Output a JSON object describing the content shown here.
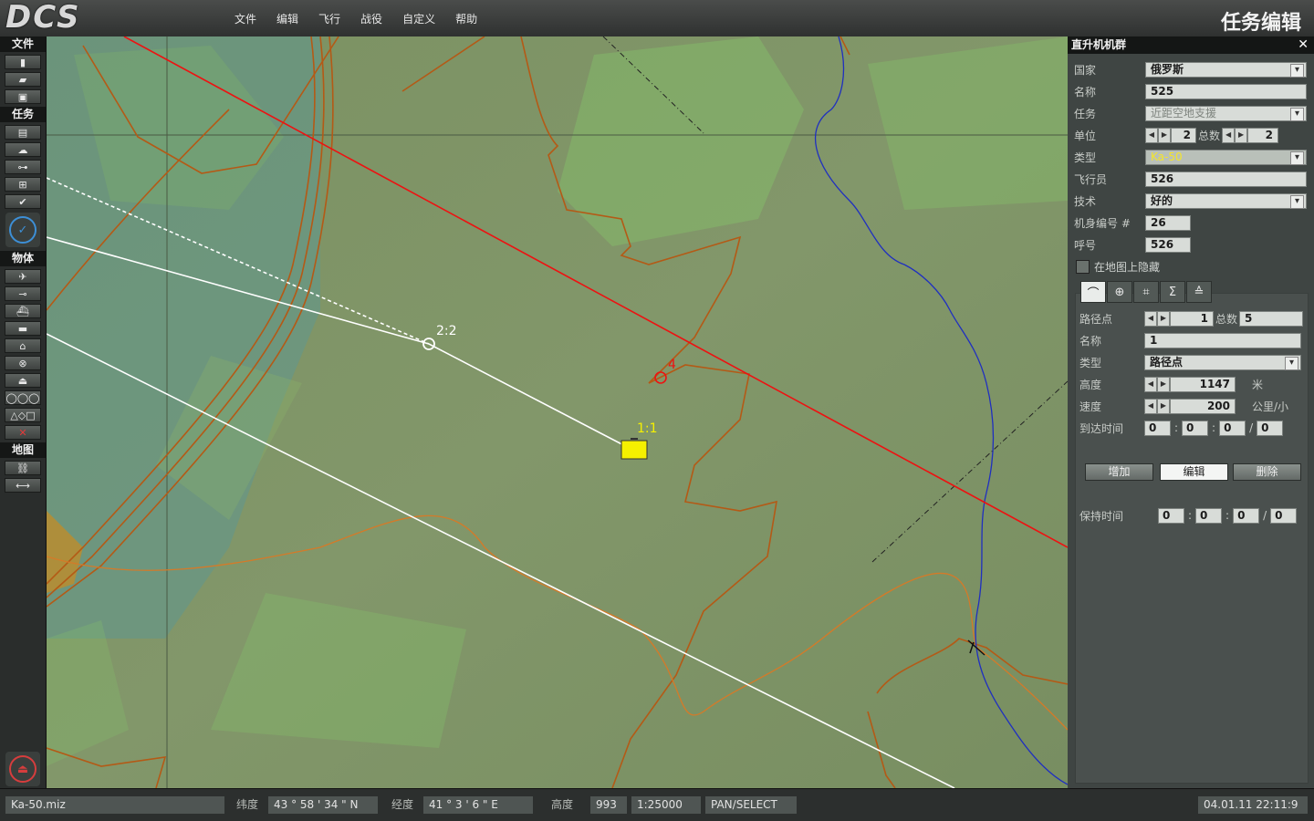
{
  "app": {
    "logo": "DCS",
    "title": "任务编辑"
  },
  "menu": [
    "文件",
    "编辑",
    "飞行",
    "战役",
    "自定义",
    "帮助"
  ],
  "toolbar": {
    "sections": {
      "file": "文件",
      "mission": "任务",
      "objects": "物体",
      "map": "地图"
    }
  },
  "map": {
    "waypoint_labels": {
      "group_start": "1:1",
      "wp2": "2:2",
      "red_marker": "4"
    },
    "colors": {
      "group_icon": "#f5f000",
      "red_route": "#ee1111",
      "white_route": "#ffffff",
      "boundary": "#b45a16",
      "river": "#1f2fc0"
    }
  },
  "panel": {
    "title": "直升机机群",
    "close": "✕",
    "country": {
      "label": "国家",
      "value": "俄罗斯"
    },
    "name": {
      "label": "名称",
      "value": "525"
    },
    "task": {
      "label": "任务",
      "value": "近距空地支援"
    },
    "unit": {
      "label": "单位",
      "value": "2",
      "total_label": "总数",
      "total": "2"
    },
    "type": {
      "label": "类型",
      "value": "Ka-50"
    },
    "pilot": {
      "label": "飞行员",
      "value": "526"
    },
    "skill": {
      "label": "技术",
      "value": "好的"
    },
    "tail": {
      "label": "机身编号 #",
      "value": "26"
    },
    "callsign": {
      "label": "呼号",
      "value": "526"
    },
    "hidden": {
      "label": "在地图上隐藏"
    },
    "waypoint": {
      "wp": {
        "label": "路径点",
        "value": "1",
        "total_label": "总数",
        "total": "5"
      },
      "name": {
        "label": "名称",
        "value": "1"
      },
      "type": {
        "label": "类型",
        "value": "路径点"
      },
      "altitude": {
        "label": "高度",
        "value": "1147",
        "unit": "米"
      },
      "speed": {
        "label": "速度",
        "value": "200",
        "unit": "公里/小"
      },
      "eta": {
        "label": "到达时间",
        "d": "0",
        "h": "0",
        "m": "0",
        "s": "0"
      },
      "buttons": {
        "add": "增加",
        "edit": "编辑",
        "delete": "删除"
      },
      "hold": {
        "label": "保持时间",
        "d": "0",
        "h": "0",
        "m": "0",
        "s": "0"
      }
    }
  },
  "status": {
    "file": "Ka-50.miz",
    "lat_label": "纬度",
    "lat": "43 ° 58 ' 34 \" N",
    "lon_label": "经度",
    "lon": "41 ° 3 ' 6 \" E",
    "alt_label": "高度",
    "alt": "993",
    "scale": "1:25000",
    "mode": "PAN/SELECT",
    "datetime": "04.01.11 22:11:9"
  }
}
